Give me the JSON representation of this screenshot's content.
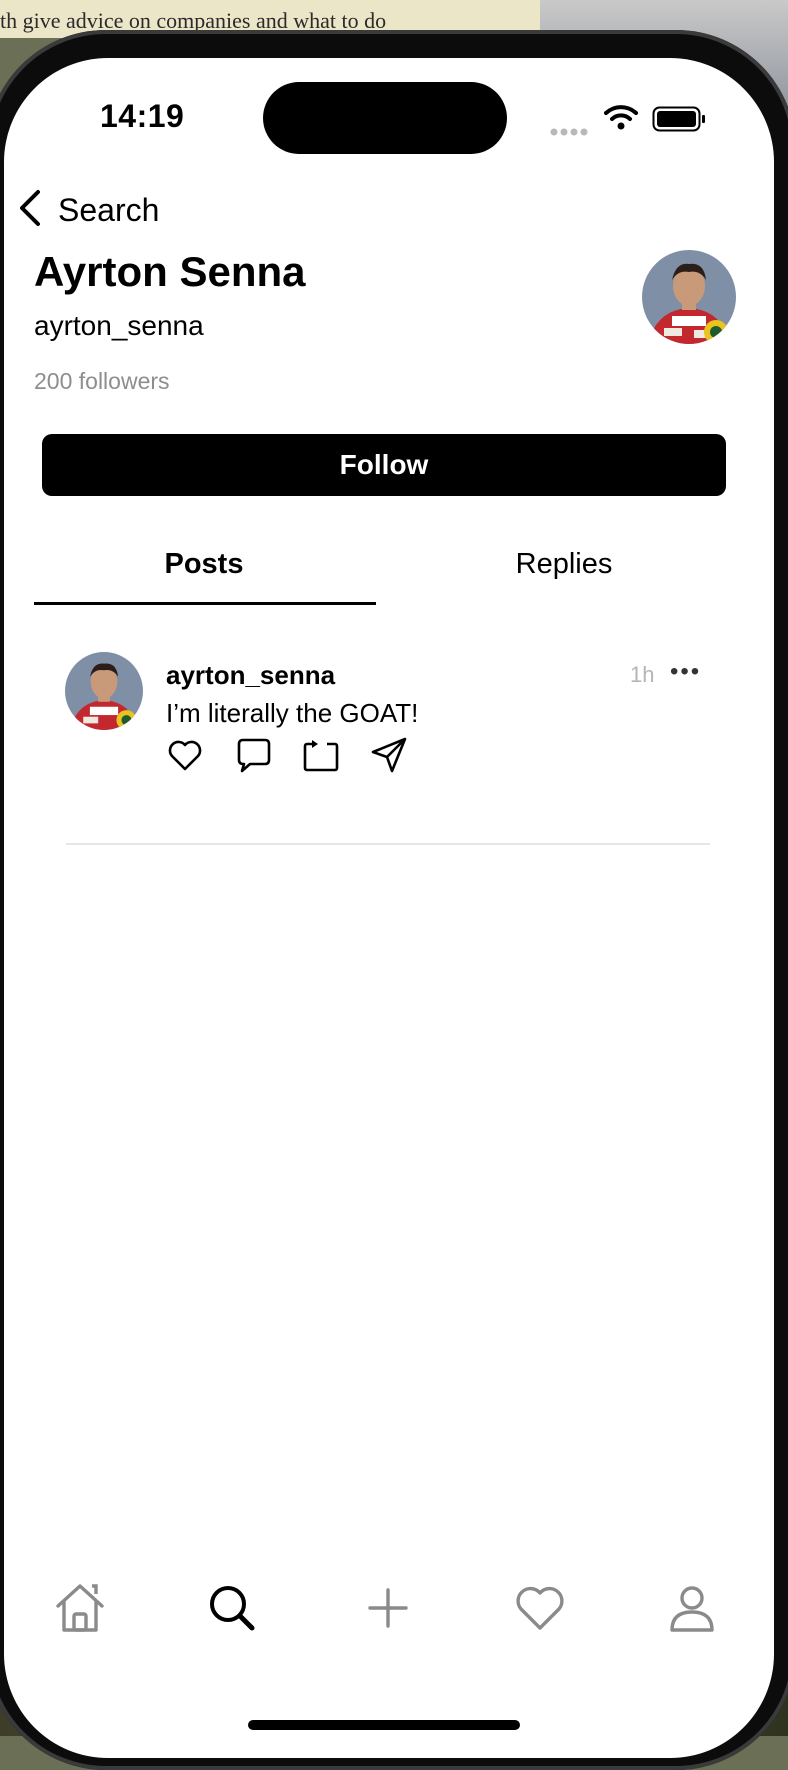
{
  "background": {
    "doc_text": "th give advice on companies and what to do"
  },
  "status_bar": {
    "time": "14:19"
  },
  "nav": {
    "back_label": "Search"
  },
  "profile": {
    "name": "Ayrton Senna",
    "handle": "ayrton_senna",
    "followers": "200 followers",
    "follow_label": "Follow"
  },
  "tabs": [
    {
      "label": "Posts",
      "active": true
    },
    {
      "label": "Replies",
      "active": false
    }
  ],
  "post": {
    "author": "ayrton_senna",
    "time": "1h",
    "more": "•••",
    "text": "I’m literally the GOAT!",
    "actions": [
      "heart-icon",
      "comment-icon",
      "repost-icon",
      "send-icon"
    ]
  },
  "tabbar": {
    "items": [
      "home-icon",
      "search-icon",
      "plus-icon",
      "heart-icon",
      "profile-icon"
    ],
    "active": "search-icon"
  },
  "colors": {
    "accent": "#000000",
    "muted": "#8e8e8e",
    "inactive_icon": "#8a8a8a"
  }
}
